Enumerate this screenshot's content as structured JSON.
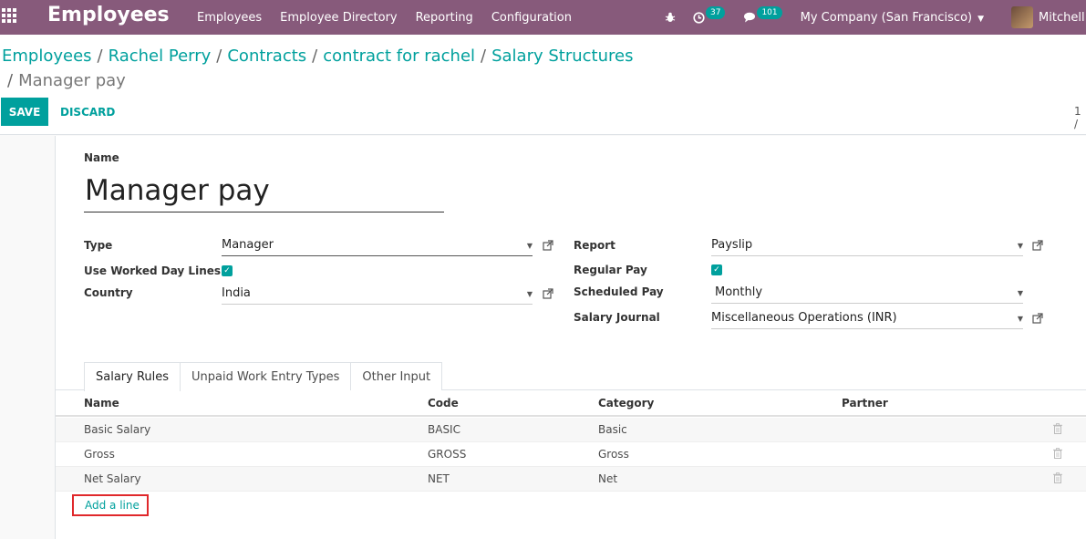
{
  "navbar": {
    "app_title": "Employees",
    "menu": [
      "Employees",
      "Employee Directory",
      "Reporting",
      "Configuration"
    ],
    "activity_count": "37",
    "message_count": "101",
    "company": "My Company (San Francisco)",
    "user": "Mitchell Adm",
    "color": "#875a7b"
  },
  "breadcrumb": {
    "items": [
      "Employees",
      "Rachel Perry",
      "Contracts",
      "contract for rachel",
      "Salary Structures"
    ],
    "current": "Manager pay",
    "separator": "/"
  },
  "toolbar": {
    "save_label": "SAVE",
    "discard_label": "DISCARD",
    "pager": "1 /"
  },
  "form": {
    "name_label": "Name",
    "name_value": "Manager pay",
    "left": {
      "type_label": "Type",
      "type_value": "Manager",
      "worked_days_label": "Use Worked Day Lines",
      "worked_days_checked": true,
      "country_label": "Country",
      "country_value": "India"
    },
    "right": {
      "report_label": "Report",
      "report_value": "Payslip",
      "regular_pay_label": "Regular Pay",
      "regular_pay_checked": true,
      "scheduled_pay_label": "Scheduled Pay",
      "scheduled_pay_value": "Monthly",
      "journal_label": "Salary Journal",
      "journal_value": "Miscellaneous Operations (INR)"
    }
  },
  "tabs": [
    "Salary Rules",
    "Unpaid Work Entry Types",
    "Other Input"
  ],
  "table": {
    "columns": [
      "Name",
      "Code",
      "Category",
      "Partner"
    ],
    "rows": [
      {
        "name": "Basic Salary",
        "code": "BASIC",
        "category": "Basic",
        "partner": ""
      },
      {
        "name": "Gross",
        "code": "GROSS",
        "category": "Gross",
        "partner": ""
      },
      {
        "name": "Net Salary",
        "code": "NET",
        "category": "Net",
        "partner": ""
      }
    ],
    "add_line": "Add a line"
  },
  "accent_color": "#00a09d"
}
